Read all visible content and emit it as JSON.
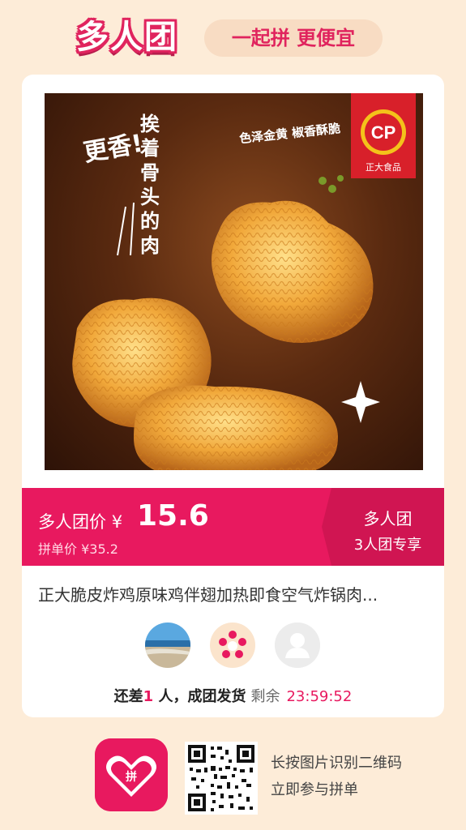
{
  "header": {
    "logo_text": "多人团",
    "slogan": "一起拼 更便宜"
  },
  "hero": {
    "vertical_text": "挨着骨头的肉",
    "slanted_text": "更香!",
    "tagline": "色泽金黄 椒香酥脆",
    "brand_badge": "CP",
    "brand_name": "正大食品"
  },
  "price": {
    "group_label": "多人团价",
    "currency": "¥",
    "group_price": "15.6",
    "single_label": "拼单价 ¥35.2",
    "tag_line1": "多人团",
    "tag_line2": "3人团专享"
  },
  "product": {
    "title": "正大脆皮炸鸡原味鸡伴翅加热即食空气炸锅肉..."
  },
  "status": {
    "prefix": "还差",
    "count": "1",
    "suffix": " 人，成团发货",
    "remaining_label": "剩余",
    "time": "23:59:52"
  },
  "footer": {
    "app_icon_text": "拼",
    "qr_line1": "长按图片识别二维码",
    "qr_line2": "立即参与拼单"
  },
  "colors": {
    "accent": "#e8195f",
    "background": "#fdecd8"
  }
}
